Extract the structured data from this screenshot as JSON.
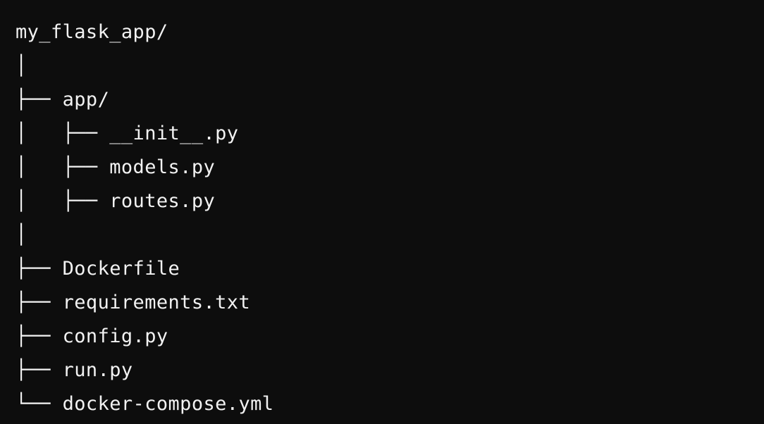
{
  "tree": {
    "lines": [
      "my_flask_app/",
      "│",
      "├── app/",
      "│   ├── __init__.py",
      "│   ├── models.py",
      "│   ├── routes.py",
      "│",
      "├── Dockerfile",
      "├── requirements.txt",
      "├── config.py",
      "├── run.py",
      "└── docker-compose.yml"
    ]
  }
}
